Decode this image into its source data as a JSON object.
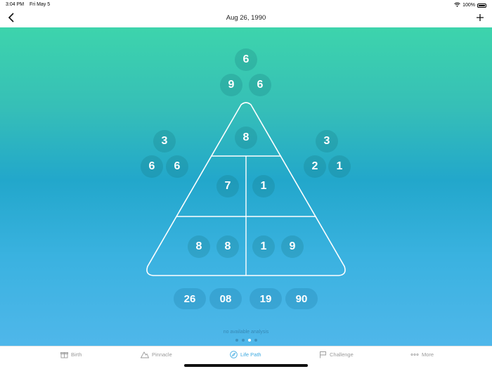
{
  "status_bar": {
    "time": "3:04 PM",
    "date": "Fri May 5",
    "battery": "100%"
  },
  "nav": {
    "title": "Aug 26, 1990"
  },
  "apex": {
    "top": "6",
    "left": "9",
    "right": "6"
  },
  "left_side": {
    "top": "3",
    "left": "6",
    "right": "6"
  },
  "right_side": {
    "top": "3",
    "left": "2",
    "right": "1"
  },
  "pyramid": {
    "peak": "8",
    "middle_left": "7",
    "middle_right": "1",
    "bottom": [
      "8",
      "8",
      "1",
      "9"
    ]
  },
  "date_parts": [
    "26",
    "08",
    "19",
    "90"
  ],
  "analysis_text": "no available analysis",
  "pager": {
    "count": 4,
    "active_index": 2
  },
  "tabs": [
    {
      "label": "Birth",
      "icon": "gift-icon"
    },
    {
      "label": "Pinnacle",
      "icon": "mountain-icon"
    },
    {
      "label": "Life Path",
      "icon": "compass-icon",
      "active": true
    },
    {
      "label": "Challenge",
      "icon": "flag-icon"
    },
    {
      "label": "More",
      "icon": "more-dots-icon"
    }
  ],
  "colors": {
    "gradient_top": "#3dd4ac",
    "gradient_bottom": "#4fb7ea",
    "active_tab": "#3aa8e0"
  }
}
